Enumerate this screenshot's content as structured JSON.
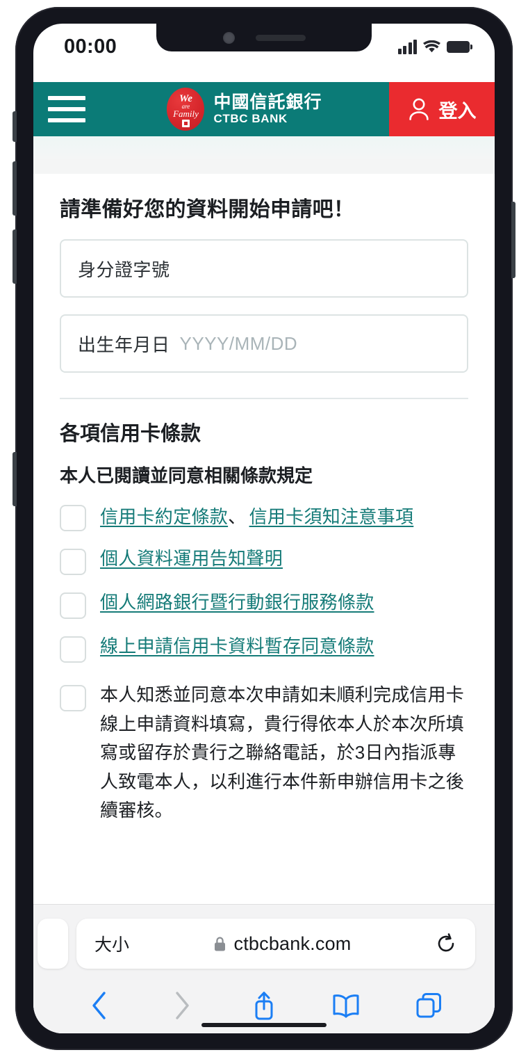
{
  "status_bar": {
    "time": "00:00",
    "icons": [
      "cellular-signal-icon",
      "wifi-icon",
      "battery-icon"
    ]
  },
  "site_header": {
    "menu_icon": "hamburger-menu-icon",
    "logo": {
      "icon": "ctbc-we-are-family-logo",
      "line1": "We",
      "line2": "are",
      "line3": "Family"
    },
    "brand_zh": "中國信託銀行",
    "brand_en": "CTBC BANK",
    "login_icon": "user-account-icon",
    "login_label": "登入",
    "colors": {
      "header_teal": "#0b7b77",
      "login_red": "#ea2b2f"
    }
  },
  "main": {
    "page_title": "請準備好您的資料開始申請吧！",
    "fields": [
      {
        "label": "身分證字號",
        "placeholder": "",
        "value": ""
      },
      {
        "label": "出生年月日",
        "placeholder": "YYYY/MM/DD",
        "value": ""
      }
    ],
    "terms_section": {
      "title": "各項信用卡條款",
      "lead": "本人已閱讀並同意相關條款規定",
      "items": [
        {
          "type": "links",
          "checked": false,
          "links": [
            "信用卡約定條款",
            "信用卡須知注意事項"
          ],
          "separator": "、"
        },
        {
          "type": "link",
          "checked": false,
          "text": "個人資料運用告知聲明"
        },
        {
          "type": "link",
          "checked": false,
          "text": "個人網路銀行暨行動銀行服務條款"
        },
        {
          "type": "link",
          "checked": false,
          "text": "線上申請信用卡資料暫存同意條款"
        },
        {
          "type": "paragraph",
          "checked": false,
          "text": "本人知悉並同意本次申請如未順利完成信用卡線上申請資料填寫，貴行得依本人於本次所填寫或留存於貴行之聯絡電話，於3日內指派專人致電本人，以利進行本件新申辦信用卡之後續審核。"
        }
      ]
    },
    "link_color": "#157b78"
  },
  "floating": {
    "service_button_icon": "customer-service-agent-icon",
    "service_button_color": "#25a19b",
    "mascot_icon": "owl-mascot"
  },
  "browser": {
    "text_size_label": "大小",
    "lock_icon": "lock-icon",
    "url": "ctbcbank.com",
    "reload_icon": "reload-icon",
    "toolbar": [
      {
        "icon": "back-arrow-icon",
        "enabled": true
      },
      {
        "icon": "forward-arrow-icon",
        "enabled": false
      },
      {
        "icon": "share-icon",
        "enabled": true
      },
      {
        "icon": "bookmarks-icon",
        "enabled": true
      },
      {
        "icon": "tabs-icon",
        "enabled": true
      }
    ],
    "accent_color": "#1b7ef4",
    "disabled_color": "#b9bcbf"
  }
}
